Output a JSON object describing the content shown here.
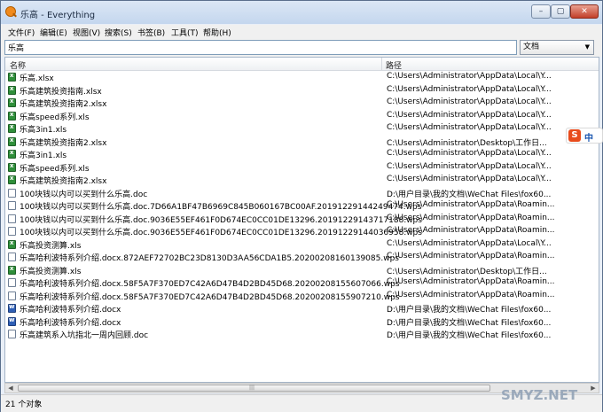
{
  "window": {
    "title": "乐高 - Everything"
  },
  "titlebar_buttons": {
    "minimize": "–",
    "maximize": "▢",
    "close": "✕"
  },
  "menu": [
    "文件(F)",
    "编辑(E)",
    "视图(V)",
    "搜索(S)",
    "书签(B)",
    "工具(T)",
    "帮助(H)"
  ],
  "search": {
    "value": "乐高"
  },
  "filter": {
    "selected": "文档"
  },
  "columns": {
    "name": "名称",
    "path": "路径"
  },
  "rows": [
    {
      "icon": "excel-icon",
      "name": "乐高.xlsx",
      "path": "C:\\Users\\Administrator\\AppData\\Local\\Y..."
    },
    {
      "icon": "excel-icon",
      "name": "乐高建筑投资指南.xlsx",
      "path": "C:\\Users\\Administrator\\AppData\\Local\\Y..."
    },
    {
      "icon": "excel-icon",
      "name": "乐高建筑投资指南2.xlsx",
      "path": "C:\\Users\\Administrator\\AppData\\Local\\Y..."
    },
    {
      "icon": "excel-icon",
      "name": "乐高speed系列.xls",
      "path": "C:\\Users\\Administrator\\AppData\\Local\\Y..."
    },
    {
      "icon": "excel-icon",
      "name": "乐高3in1.xls",
      "path": "C:\\Users\\Administrator\\AppData\\Local\\Y..."
    },
    {
      "icon": "excel-icon",
      "name": "乐高建筑投资指南2.xlsx",
      "path": "C:\\Users\\Administrator\\Desktop\\工作日..."
    },
    {
      "icon": "excel-icon",
      "name": "乐高3in1.xls",
      "path": "C:\\Users\\Administrator\\AppData\\Local\\Y..."
    },
    {
      "icon": "excel-icon",
      "name": "乐高speed系列.xls",
      "path": "C:\\Users\\Administrator\\AppData\\Local\\Y..."
    },
    {
      "icon": "excel-icon",
      "name": "乐高建筑投资指南2.xlsx",
      "path": "C:\\Users\\Administrator\\AppData\\Local\\Y..."
    },
    {
      "icon": "doc-icon",
      "name": "100块钱以内可以买到什么乐高.doc",
      "path": "D:\\用户目录\\我的文档\\WeChat Files\\fox60..."
    },
    {
      "icon": "wps-icon",
      "name": "100块钱以内可以买到什么乐高.doc.7D66A1BF47B6969C845B060167BC00AF.20191229144249474.wps",
      "path": "C:\\Users\\Administrator\\AppData\\Roamin..."
    },
    {
      "icon": "wps-icon",
      "name": "100块钱以内可以买到什么乐高.doc.9036E55EF461F0D674EC0CC01DE13296.20191229143717188.wps",
      "path": "C:\\Users\\Administrator\\AppData\\Roamin..."
    },
    {
      "icon": "wps-icon",
      "name": "100块钱以内可以买到什么乐高.doc.9036E55EF461F0D674EC0CC01DE13296.20191229144036958.wps",
      "path": "C:\\Users\\Administrator\\AppData\\Roamin..."
    },
    {
      "icon": "excel-icon",
      "name": "乐高投资测算.xls",
      "path": "C:\\Users\\Administrator\\AppData\\Local\\Y..."
    },
    {
      "icon": "wps-icon",
      "name": "乐高哈利波特系列介绍.docx.872AEF72702BC23D8130D3AA56CDA1B5.20200208160139085.wps",
      "path": "C:\\Users\\Administrator\\AppData\\Roamin..."
    },
    {
      "icon": "excel-icon",
      "name": "乐高投资测算.xls",
      "path": "C:\\Users\\Administrator\\Desktop\\工作日..."
    },
    {
      "icon": "wps-icon",
      "name": "乐高哈利波特系列介绍.docx.58F5A7F370ED7C42A6D47B4D2BD45D68.20200208155607066.wps",
      "path": "C:\\Users\\Administrator\\AppData\\Roamin..."
    },
    {
      "icon": "wps-icon",
      "name": "乐高哈利波特系列介绍.docx.58F5A7F370ED7C42A6D47B4D2BD45D68.20200208155907210.wps",
      "path": "C:\\Users\\Administrator\\AppData\\Roamin..."
    },
    {
      "icon": "word-icon",
      "name": "乐高哈利波特系列介绍.docx",
      "path": "D:\\用户目录\\我的文档\\WeChat Files\\fox60..."
    },
    {
      "icon": "word-icon",
      "name": "乐高哈利波特系列介绍.docx",
      "path": "D:\\用户目录\\我的文档\\WeChat Files\\fox60..."
    },
    {
      "icon": "doc-icon",
      "name": "乐高建筑系入坑指北一周内回顾.doc",
      "path": "D:\\用户目录\\我的文档\\WeChat Files\\fox60..."
    }
  ],
  "status": {
    "text": "21 个对象"
  },
  "ime": {
    "logo": "S",
    "mode": "中"
  },
  "watermark": {
    "text": "SMYZ.NET"
  }
}
